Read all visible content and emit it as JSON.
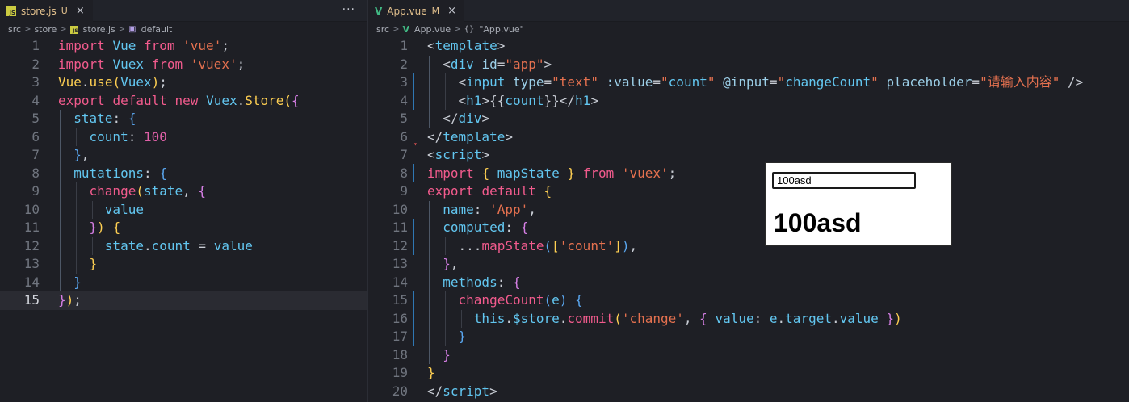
{
  "left_editor": {
    "tab": {
      "title": "store.js",
      "status": "U",
      "close": "×",
      "icon": "js-file-icon"
    },
    "more_actions": "···",
    "breadcrumbs": [
      "src",
      "store",
      "store.js",
      "default"
    ],
    "line_numbers": [
      "1",
      "2",
      "3",
      "4",
      "5",
      "6",
      "7",
      "8",
      "9",
      "10",
      "11",
      "12",
      "13",
      "14",
      "15"
    ],
    "current_line": "15"
  },
  "right_editor": {
    "tab": {
      "title": "App.vue",
      "status": "M",
      "close": "×",
      "icon": "vue-file-icon"
    },
    "breadcrumbs": [
      "src",
      "App.vue",
      "\"App.vue\""
    ],
    "line_numbers": [
      "1",
      "2",
      "3",
      "4",
      "5",
      "6",
      "7",
      "8",
      "9",
      "10",
      "11",
      "12",
      "13",
      "14",
      "15",
      "16",
      "17",
      "18",
      "19",
      "20"
    ]
  },
  "preview": {
    "input_value": "100asd",
    "heading": "100asd"
  },
  "colors": {
    "editor_bg": "#1e1f25",
    "keyword": "#f25b8d",
    "string": "#e5714f",
    "function": "#fecf52",
    "variable": "#62c6f0",
    "number": "#e060a8"
  }
}
